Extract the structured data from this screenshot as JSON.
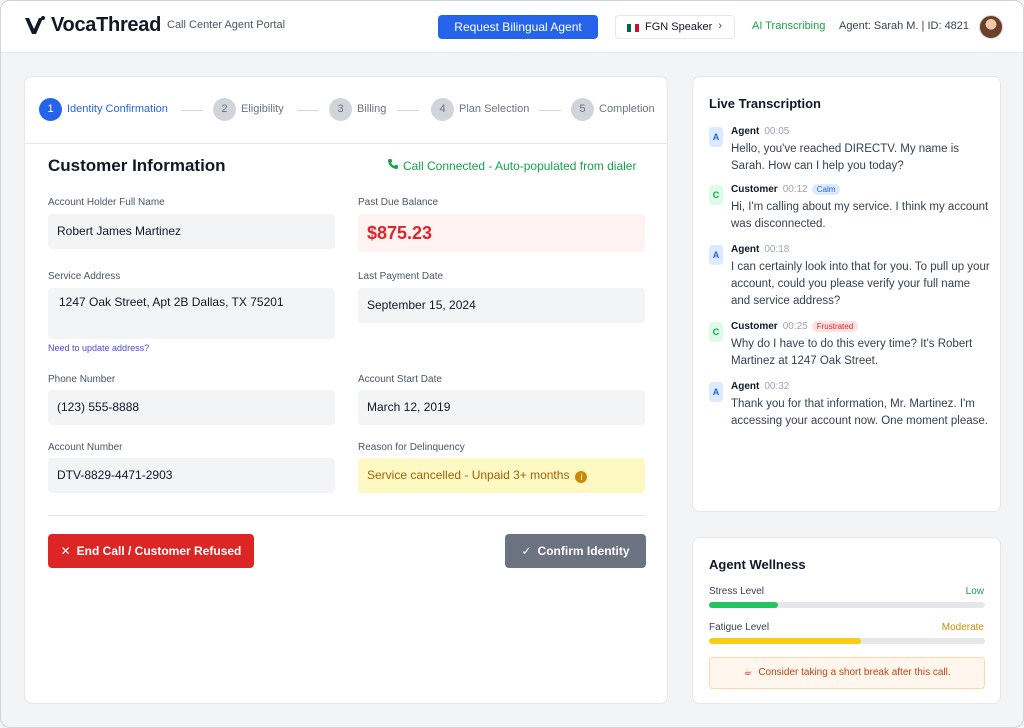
{
  "header": {
    "brand": "VocaThread",
    "portal": "Call Center Agent Portal",
    "request_button": "Request Bilingual Agent",
    "speaker": {
      "label": "FGN Speaker",
      "flag_colors": [
        "#006847",
        "#ffffff",
        "#ce1126"
      ]
    },
    "ai_status": "AI Transcribing",
    "agent": "Agent: Sarah M. | ID: 4821"
  },
  "stepper": [
    {
      "num": "1",
      "label": "Identity Confirmation",
      "active": true
    },
    {
      "num": "2",
      "label": "Eligibility",
      "active": false
    },
    {
      "num": "3",
      "label": "Billing",
      "active": false
    },
    {
      "num": "4",
      "label": "Plan Selection",
      "active": false
    },
    {
      "num": "5",
      "label": "Completion",
      "active": false
    }
  ],
  "customer": {
    "title": "Customer Information",
    "call_status": "Call Connected - Auto-populated from dialer",
    "fields": {
      "name_label": "Account Holder Full Name",
      "name": "Robert James Martinez",
      "balance_label": "Past Due Balance",
      "balance": "$875.23",
      "address_label": "Service Address",
      "address": "1247 Oak Street, Apt 2B Dallas, TX 75201",
      "update_link": "Need to update address?",
      "last_payment_label": "Last Payment Date",
      "last_payment": "September 15, 2024",
      "phone_label": "Phone Number",
      "phone": "(123) 555-8888",
      "start_label": "Account Start Date",
      "start": "March 12, 2019",
      "account_label": "Account Number",
      "account": "DTV-8829-4471-2903",
      "reason_label": "Reason for Delinquency",
      "reason": "Service cancelled - Unpaid 3+ months"
    },
    "end_call": "End Call / Customer Refused",
    "confirm": "Confirm Identity"
  },
  "transcription": {
    "title": "Live Transcription",
    "messages": [
      {
        "badge": "A",
        "speaker": "Agent",
        "time": "00:05",
        "mood": "",
        "text": "Hello, you've reached DIRECTV. My name is Sarah. How can I help you today?"
      },
      {
        "badge": "C",
        "speaker": "Customer",
        "time": "00:12",
        "mood": "Calm",
        "text": "Hi, I'm calling about my service. I think my account was disconnected."
      },
      {
        "badge": "A",
        "speaker": "Agent",
        "time": "00:18",
        "mood": "",
        "text": "I can certainly look into that for you. To pull up your account, could you please verify your full name and service address?"
      },
      {
        "badge": "C",
        "speaker": "Customer",
        "time": "00:25",
        "mood": "Frustrated",
        "text": "Why do I have to do this every time? It's Robert Martinez at 1247 Oak Street."
      },
      {
        "badge": "A",
        "speaker": "Agent",
        "time": "00:32",
        "mood": "",
        "text": "Thank you for that information, Mr. Martinez. I'm accessing your account now. One moment please."
      }
    ]
  },
  "wellness": {
    "title": "Agent Wellness",
    "stress_label": "Stress Level",
    "stress_value": "Low",
    "stress_level": 0.25,
    "stress_color": "#22c55e",
    "fatigue_label": "Fatigue Level",
    "fatigue_value": "Moderate",
    "fatigue_level": 0.55,
    "fatigue_color": "#facc15",
    "tip": "Consider taking a short break after this call."
  }
}
